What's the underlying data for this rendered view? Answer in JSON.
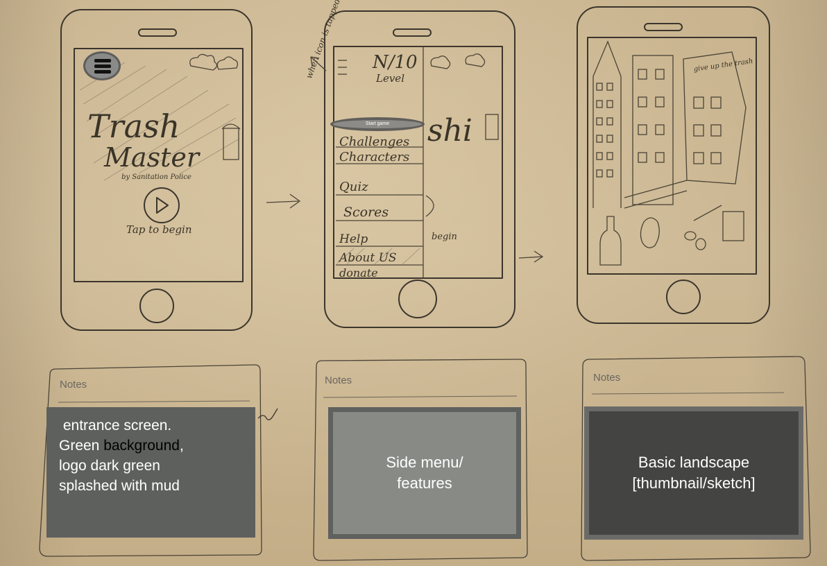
{
  "phone1": {
    "title_line1": "Trash",
    "title_line2": "Master",
    "byline": "by Sanitation Police",
    "tap_label": "Tap to begin"
  },
  "phone2": {
    "level_counter": "N/10",
    "level_label": "Level",
    "margin_note": "when icon is tapped",
    "start_button": "Start game",
    "menu_items": [
      "Challenges",
      "Characters",
      "Quiz",
      "Scores",
      "Help",
      "About US",
      "donate"
    ],
    "behind_title": "shi",
    "behind_tap": "begin"
  },
  "phone3": {
    "sign_text": "give up the trash"
  },
  "notes": {
    "label": "Notes",
    "note1_line1": "entrance screen.",
    "note1_green": "Green ",
    "note1_background": "background",
    "note1_comma": ",",
    "note1_line3": "logo dark green",
    "note1_line4": "splashed with mud",
    "note2_text": "Side menu/ features",
    "note3_text": "Basic landscape [thumbnail/sketch]"
  }
}
